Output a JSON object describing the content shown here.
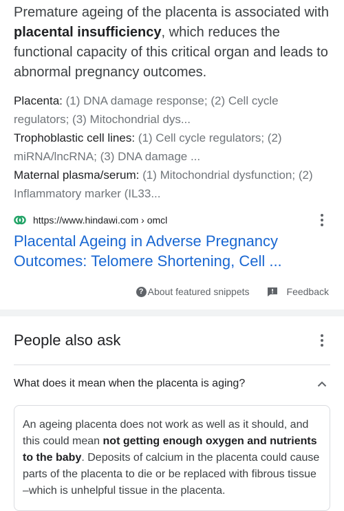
{
  "snippet": {
    "part1": "Premature ageing of the placenta is associated with ",
    "bold": "placental insufficiency",
    "part2": ", which reduces the functional capacity of this critical organ and leads to abnormal pregnancy outcomes."
  },
  "facts": [
    {
      "key": "Placenta:",
      "value": " (1) DNA damage response; (2) Cell cycle regulators; (3) Mitochondrial dys..."
    },
    {
      "key": "Trophoblastic cell lines:",
      "value": " (1) Cell cycle regulators; (2) miRNA/lncRNA; (3) DNA damage ..."
    },
    {
      "key": "Maternal plasma/serum:",
      "value": " (1) Mitochondrial dysfunction; (2) Inflammatory marker (IL33..."
    }
  ],
  "source": {
    "url": "https://www.hindawi.com › omcl",
    "title": "Placental Ageing in Adverse Pregnancy Outcomes: Telomere Shortening, Cell ..."
  },
  "meta": {
    "about_label": "About featured snippets",
    "feedback_label": "Feedback"
  },
  "paa": {
    "title": "People also ask",
    "question": "What does it mean when the placenta is aging?",
    "answer_part1": "An ageing placenta does not work as well as it should, and this could mean ",
    "answer_bold": "not getting enough oxygen and nutrients to the baby",
    "answer_part2": ". Deposits of calcium in the placenta could cause parts of the placenta to die or be replaced with fibrous tissue –which is unhelpful tissue in the placenta."
  },
  "colors": {
    "link": "#1967d2",
    "favicon": "#21a366"
  },
  "icons": [
    "hindawi-favicon-icon",
    "more-vert-icon",
    "help-circle-icon",
    "feedback-icon",
    "chevron-up-icon"
  ]
}
